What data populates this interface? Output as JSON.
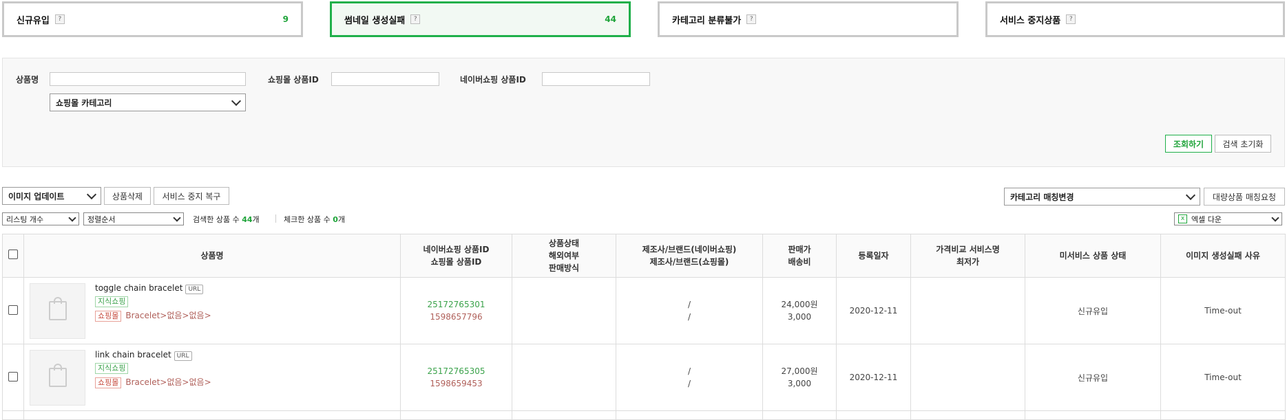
{
  "status_tabs": [
    {
      "label": "신규유입",
      "count": "9"
    },
    {
      "label": "썸네일 생성실패",
      "count": "44"
    },
    {
      "label": "카테고리 분류불가",
      "count": ""
    },
    {
      "label": "서비스 중지상품",
      "count": ""
    }
  ],
  "help_glyph": "?",
  "search": {
    "product_name_label": "상품명",
    "mall_product_id_label": "쇼핑몰 상품ID",
    "naver_product_id_label": "네이버쇼핑 상품ID",
    "category_select": "쇼핑몰 카테고리",
    "search_button": "조회하기",
    "reset_button": "검색 초기화"
  },
  "toolbar": {
    "image_update_select": "이미지 업데이트",
    "delete_button": "상품삭제",
    "restore_button": "서비스 중지 복구",
    "category_match_select": "카테고리 매칭변경",
    "bulk_match_button": "대량상품 매칭요청",
    "listing_count_select": "리스팅 개수",
    "sort_select": "정렬순서",
    "searched_prefix": "검색한 상품 수 ",
    "searched_count": "44",
    "unit": "개",
    "checked_prefix": "체크한 상품 수 ",
    "checked_count": "0",
    "excel_select": "엑셀 다운",
    "excel_icon_glyph": "x"
  },
  "table": {
    "headers": {
      "product_name": "상품명",
      "ids_line1": "네이버쇼핑 상품ID",
      "ids_line2": "쇼핑몰 상품ID",
      "status_line1": "상품상태",
      "status_line2": "해외여부",
      "status_line3": "판매방식",
      "maker_line1": "제조사/브랜드(네이버쇼핑)",
      "maker_line2": "제조사/브랜드(쇼핑몰)",
      "price_line1": "판매가",
      "price_line2": "배송비",
      "reg_date": "등록일자",
      "compare_line1": "가격비교 서비스명",
      "compare_line2": "최저가",
      "unserviced_status": "미서비스 상품 상태",
      "fail_reason": "이미지 생성실패 사유"
    },
    "rows": [
      {
        "name": "toggle chain bracelet",
        "url_tag": "URL",
        "tag_naver": "지식쇼핑",
        "tag_mall": "쇼핑몰",
        "category_path": "Bracelet>없음>없음>",
        "naver_id": "25172765301",
        "mall_id": "1598657796",
        "maker_naver": "/",
        "maker_mall": "/",
        "price": "24,000원",
        "shipping": "3,000",
        "reg_date": "2020-12-11",
        "compare": "",
        "unserviced_status": "신규유입",
        "fail_reason": "Time-out"
      },
      {
        "name": "link chain bracelet",
        "url_tag": "URL",
        "tag_naver": "지식쇼핑",
        "tag_mall": "쇼핑몰",
        "category_path": "Bracelet>없음>없음>",
        "naver_id": "25172765305",
        "mall_id": "1598659453",
        "maker_naver": "/",
        "maker_mall": "/",
        "price": "27,000원",
        "shipping": "3,000",
        "reg_date": "2020-12-11",
        "compare": "",
        "unserviced_status": "신규유입",
        "fail_reason": "Time-out"
      }
    ]
  }
}
